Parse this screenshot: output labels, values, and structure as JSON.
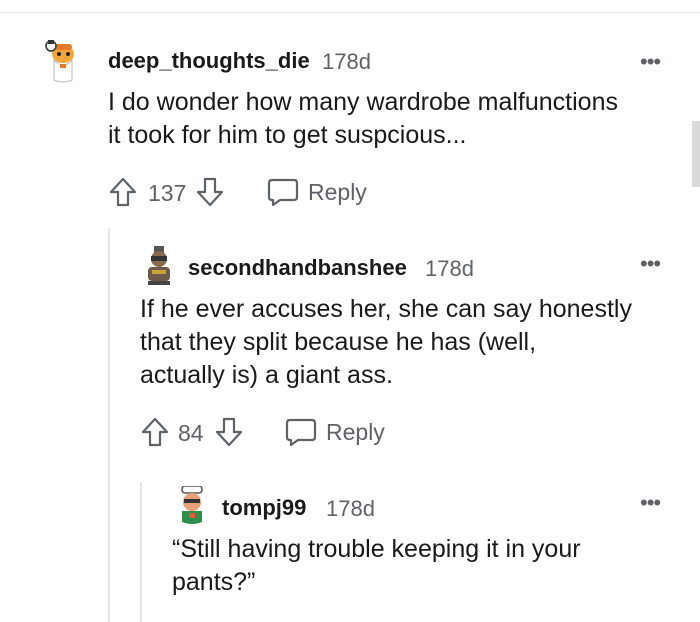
{
  "comments": [
    {
      "author": "deep_thoughts_die",
      "age": "178d",
      "body": "I do wonder how many wardrobe malfunctions\nit took for him to get suspcious...",
      "votes": "137",
      "reply_label": "Reply",
      "more_label": "•••"
    },
    {
      "author": "secondhandbanshee",
      "age": "178d",
      "body": "If he ever accuses her, she can say honestly\nthat they split because he has (well,\nactually is) a giant ass.",
      "votes": "84",
      "reply_label": "Reply",
      "more_label": "•••"
    },
    {
      "author": "tompj99",
      "age": "178d",
      "body": "“Still having trouble keeping it in your\npants?”",
      "more_label": "•••"
    }
  ],
  "colors": {
    "text": "#1a1a1b",
    "meta": "#5f6368",
    "thread_line": "#e5e5e5"
  }
}
